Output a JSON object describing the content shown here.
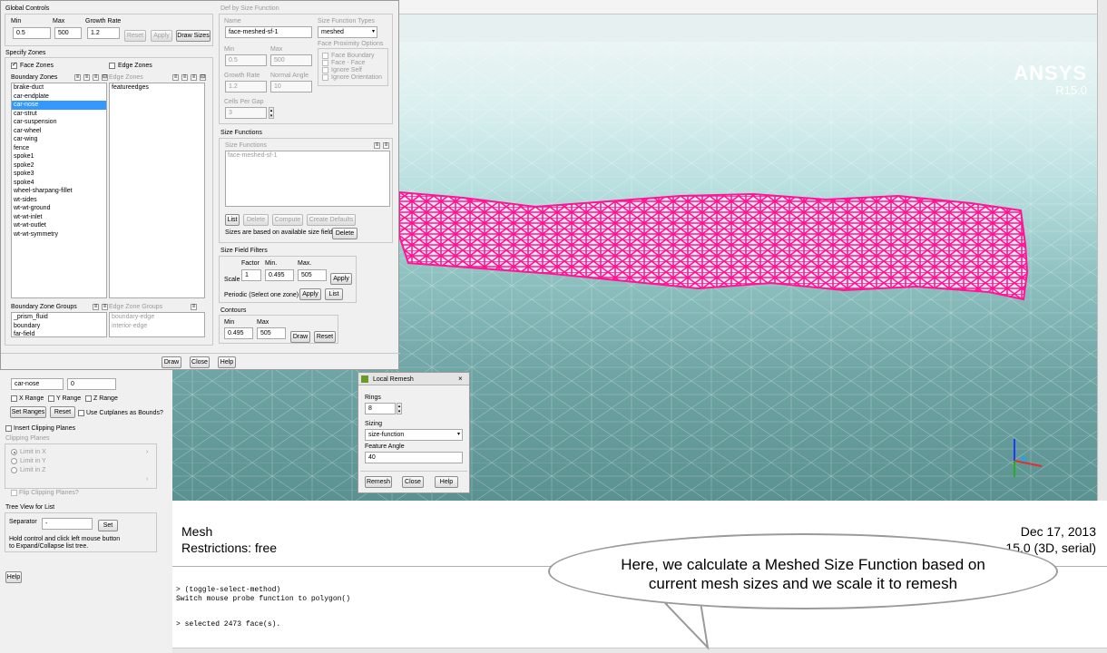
{
  "global_controls": {
    "title": "Global Controls",
    "min_label": "Min",
    "max_label": "Max",
    "growth_rate_label": "Growth Rate",
    "min_value": "0.5",
    "max_value": "500",
    "growth_rate_value": "1.2",
    "reset": "Reset",
    "apply": "Apply",
    "draw_sizes": "Draw Sizes"
  },
  "specify_zones": {
    "title": "Specify Zones",
    "face_zones": "Face Zones",
    "edge_zones": "Edge Zones",
    "boundary_zones_label": "Boundary Zones",
    "edge_zones_label": "Edge Zones",
    "boundary_zones": [
      "brake-duct",
      "car-endplate",
      "car-nose",
      "car-strut",
      "car-suspension",
      "car-wheel",
      "car-wing",
      "fence",
      "spoke1",
      "spoke2",
      "spoke3",
      "spoke4",
      "wheel-sharpang-fillet",
      "wt-sides",
      "wt-wt-ground",
      "wt-wt-inlet",
      "wt-wt-outlet",
      "wt-wt-symmetry"
    ],
    "selected_zone": "car-nose",
    "edge_zone_items": [
      "featureedges"
    ],
    "boundary_zone_groups_label": "Boundary Zone Groups",
    "boundary_zone_groups": [
      "_prism_fluid",
      "boundary",
      "far-field"
    ],
    "edge_zone_groups_label": "Edge Zone Groups",
    "edge_zone_groups": [
      "boundary-edge",
      "interior-edge"
    ]
  },
  "size_function_def": {
    "title": "Def by Size Function",
    "name_label": "Name",
    "name_value": "face-meshed-sf-1",
    "type_label": "Size Function Types",
    "type_value": "meshed",
    "proximity_label": "Face Proximity Options",
    "proximity_options": [
      "Face Boundary",
      "Face - Face",
      "Ignore Self",
      "Ignore Orientation"
    ],
    "min_label": "Min",
    "min_value": "0.5",
    "max_label": "Max",
    "max_value": "500",
    "growth_rate_label": "Growth Rate",
    "growth_rate_value": "1.2",
    "normal_angle_label": "Normal Angle",
    "normal_angle_value": "10",
    "cells_per_gap_label": "Cells Per Gap",
    "cells_per_gap_value": "3"
  },
  "size_functions": {
    "title": "Size Functions",
    "list_label": "Size Functions",
    "items": [
      "face-meshed-sf-1"
    ],
    "list": "List",
    "delete": "Delete",
    "compute": "Compute",
    "create_defaults": "Create Defaults",
    "note": "Sizes are based on available size field.",
    "delete2": "Delete"
  },
  "size_field_filters": {
    "title": "Size Field Filters",
    "factor_label": "Factor",
    "min_label": "Min.",
    "max_label": "Max.",
    "scale_label": "Scale",
    "factor_value": "1",
    "min_value": "0.495",
    "max_value": "505",
    "apply": "Apply",
    "periodic_label": "Periodic (Select one zone)",
    "apply2": "Apply",
    "list": "List"
  },
  "contours": {
    "title": "Contours",
    "min_label": "Min",
    "max_label": "Max",
    "min_value": "0.495",
    "max_value": "505",
    "draw": "Draw",
    "reset": "Reset"
  },
  "dialog_footer": {
    "draw": "Draw",
    "close": "Close",
    "help": "Help"
  },
  "left_panel": {
    "zone_field": "car-nose",
    "zone_value": "0",
    "x_range": "X Range",
    "y_range": "Y Range",
    "z_range": "Z Range",
    "set_ranges": "Set Ranges",
    "reset": "Reset",
    "use_cutplanes": "Use Cutplanes as Bounds?",
    "insert_clipping": "Insert Clipping Planes",
    "clipping_planes": "Clipping Planes",
    "limits": [
      "Limit in X",
      "Limit in Y",
      "Limit in Z"
    ],
    "flip_clipping": "Flip Clipping Planes?",
    "tree_view": "Tree View for List",
    "separator_label": "Separator",
    "separator_value": "-",
    "set": "Set",
    "hint_line1": "Hold control and click left mouse button",
    "hint_line2": "to Expand/Collapse list tree.",
    "help": "Help"
  },
  "local_remesh": {
    "title": "Local Remesh",
    "rings_label": "Rings",
    "rings_value": "8",
    "sizing_label": "Sizing",
    "sizing_value": "size-function",
    "feature_angle_label": "Feature Angle",
    "feature_angle_value": "40",
    "remesh": "Remesh",
    "close": "Close",
    "help": "Help"
  },
  "viewport": {
    "brand": "ANSYS",
    "version": "R15.0",
    "mesh_label": "Mesh",
    "restrictions": "Restrictions:  free",
    "date": "Dec 17, 2013",
    "solver": "15.0 (3D, serial)",
    "mesh_color": "#ff1493",
    "background_color": "#8fc1c1"
  },
  "console": {
    "lines": [
      "> (toggle-select-method)",
      "Switch mouse probe function to polygon()",
      "",
      "> selected 2473 face(s)."
    ]
  },
  "caption": {
    "line1": "Here, we calculate a Meshed Size Function based on",
    "line2": "current mesh sizes and we scale it to remesh"
  }
}
